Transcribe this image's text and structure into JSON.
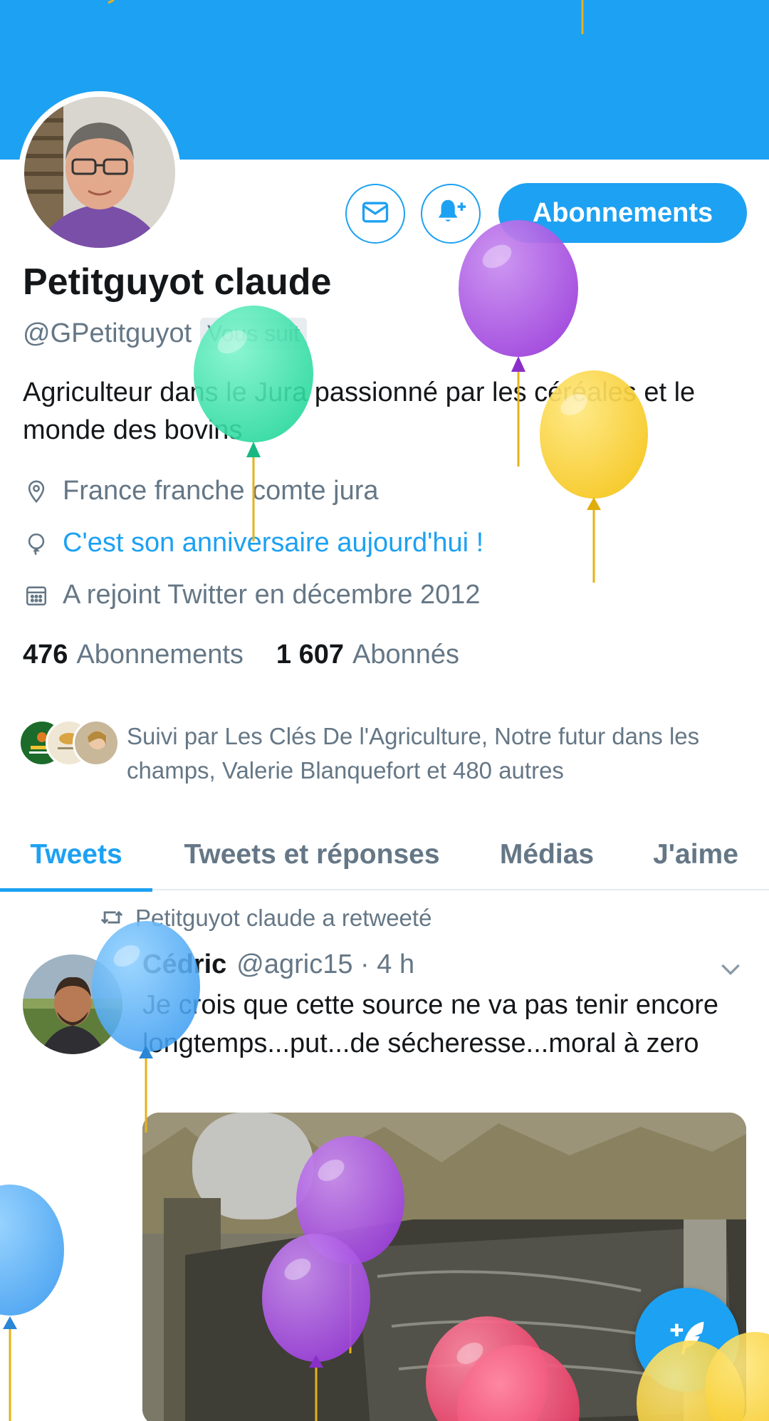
{
  "profile": {
    "name": "Petitguyot claude",
    "handle": "@GPetitguyot",
    "follows_you": "Vous suit",
    "bio": "Agriculteur dans le Jura passionné par les céréales et le monde des bovins",
    "location": "France franche comte jura",
    "birthday": "C'est son anniversaire aujourd'hui !",
    "joined": "A rejoint Twitter en décembre 2012",
    "following_count": "476",
    "following_label": "Abonnements",
    "followers_count": "1 607",
    "followers_label": "Abonnés",
    "followed_by": "Suivi par Les Clés De l'Agriculture, Notre futur dans les champs, Valerie Blanquefort et 480 autres"
  },
  "actions": {
    "follow_button": "Abonnements",
    "message_icon": "envelope-icon",
    "notify_icon": "bell-plus-icon"
  },
  "tabs": [
    {
      "label": "Tweets",
      "active": true
    },
    {
      "label": "Tweets et réponses",
      "active": false
    },
    {
      "label": "Médias",
      "active": false
    },
    {
      "label": "J'aime",
      "active": false
    }
  ],
  "tweet": {
    "retweet_line": "Petitguyot claude a retweeté",
    "author_name": "Cédric",
    "author_meta": "@agric15 · 4 h",
    "text": "Je crois que cette source ne va pas tenir encore longtemps...put...de sécheresse...moral à zero"
  },
  "colors": {
    "accent": "#1da1f2",
    "secondary_text": "#657786",
    "primary_text": "#14171a"
  }
}
